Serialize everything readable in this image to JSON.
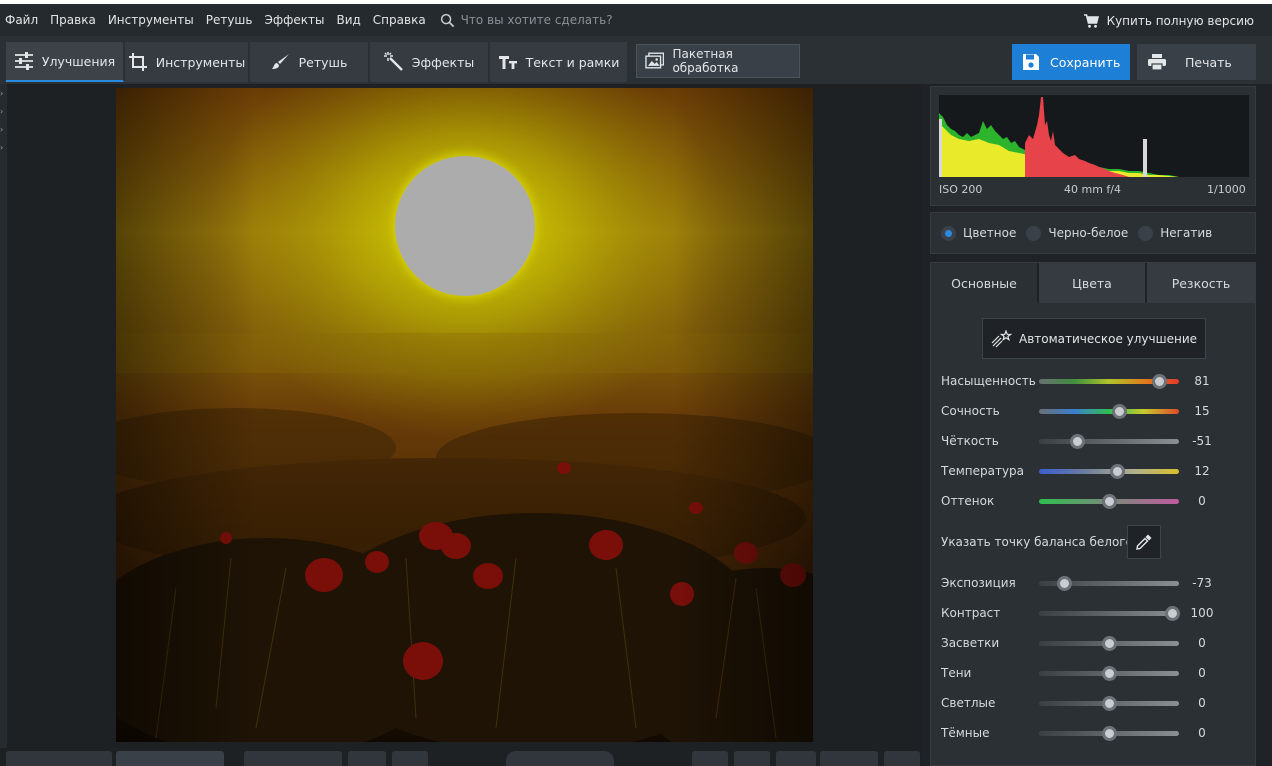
{
  "menu": {
    "items": [
      "Файл",
      "Правка",
      "Инструменты",
      "Ретушь",
      "Эффекты",
      "Вид",
      "Справка"
    ],
    "search_placeholder": "Что вы хотите сделать?",
    "buy_full_version": "Купить полную версию"
  },
  "toolbar": {
    "tabs": [
      {
        "label": "Улучшения",
        "icon": "sliders-icon",
        "active": true
      },
      {
        "label": "Инструменты",
        "icon": "crop-icon",
        "active": false
      },
      {
        "label": "Ретушь",
        "icon": "brush-icon",
        "active": false
      },
      {
        "label": "Эффекты",
        "icon": "magic-wand-icon",
        "active": false
      },
      {
        "label": "Текст и рамки",
        "icon": "text-icon",
        "active": false
      }
    ],
    "batch_label": "Пакетная обработка",
    "save_label": "Сохранить",
    "print_label": "Печать",
    "edge_glyph": "а,"
  },
  "histogram": {
    "iso": "ISO 200",
    "lens": "40 mm f/4",
    "shutter": "1/1000"
  },
  "color_modes": {
    "options": [
      "Цветное",
      "Черно-белое",
      "Негатив"
    ],
    "selected": "Цветное"
  },
  "adjust": {
    "tabs": [
      "Основные",
      "Цвета",
      "Резкость"
    ],
    "active_tab": "Основные",
    "auto_label": "Автоматическое улучшение",
    "white_balance_label": "Указать точку баланса белого",
    "sliders_top": [
      {
        "label": "Насыщенность",
        "value": "81",
        "fraction": 0.86
      },
      {
        "label": "Сочность",
        "value": "15",
        "fraction": 0.57
      },
      {
        "label": "Чёткость",
        "value": "-51",
        "fraction": 0.27
      },
      {
        "label": "Температура",
        "value": "12",
        "fraction": 0.56
      },
      {
        "label": "Оттенок",
        "value": "0",
        "fraction": 0.5
      }
    ],
    "sliders_bottom": [
      {
        "label": "Экспозиция",
        "value": "-73",
        "fraction": 0.18
      },
      {
        "label": "Контраст",
        "value": "100",
        "fraction": 0.95
      },
      {
        "label": "Засветки",
        "value": "0",
        "fraction": 0.5
      },
      {
        "label": "Тени",
        "value": "0",
        "fraction": 0.5
      },
      {
        "label": "Светлые",
        "value": "0",
        "fraction": 0.5
      },
      {
        "label": "Тёмные",
        "value": "0",
        "fraction": 0.5
      }
    ]
  },
  "colors": {
    "accent": "#2a8adf",
    "save_button": "#1e7fd6",
    "background": "#1f2327"
  }
}
